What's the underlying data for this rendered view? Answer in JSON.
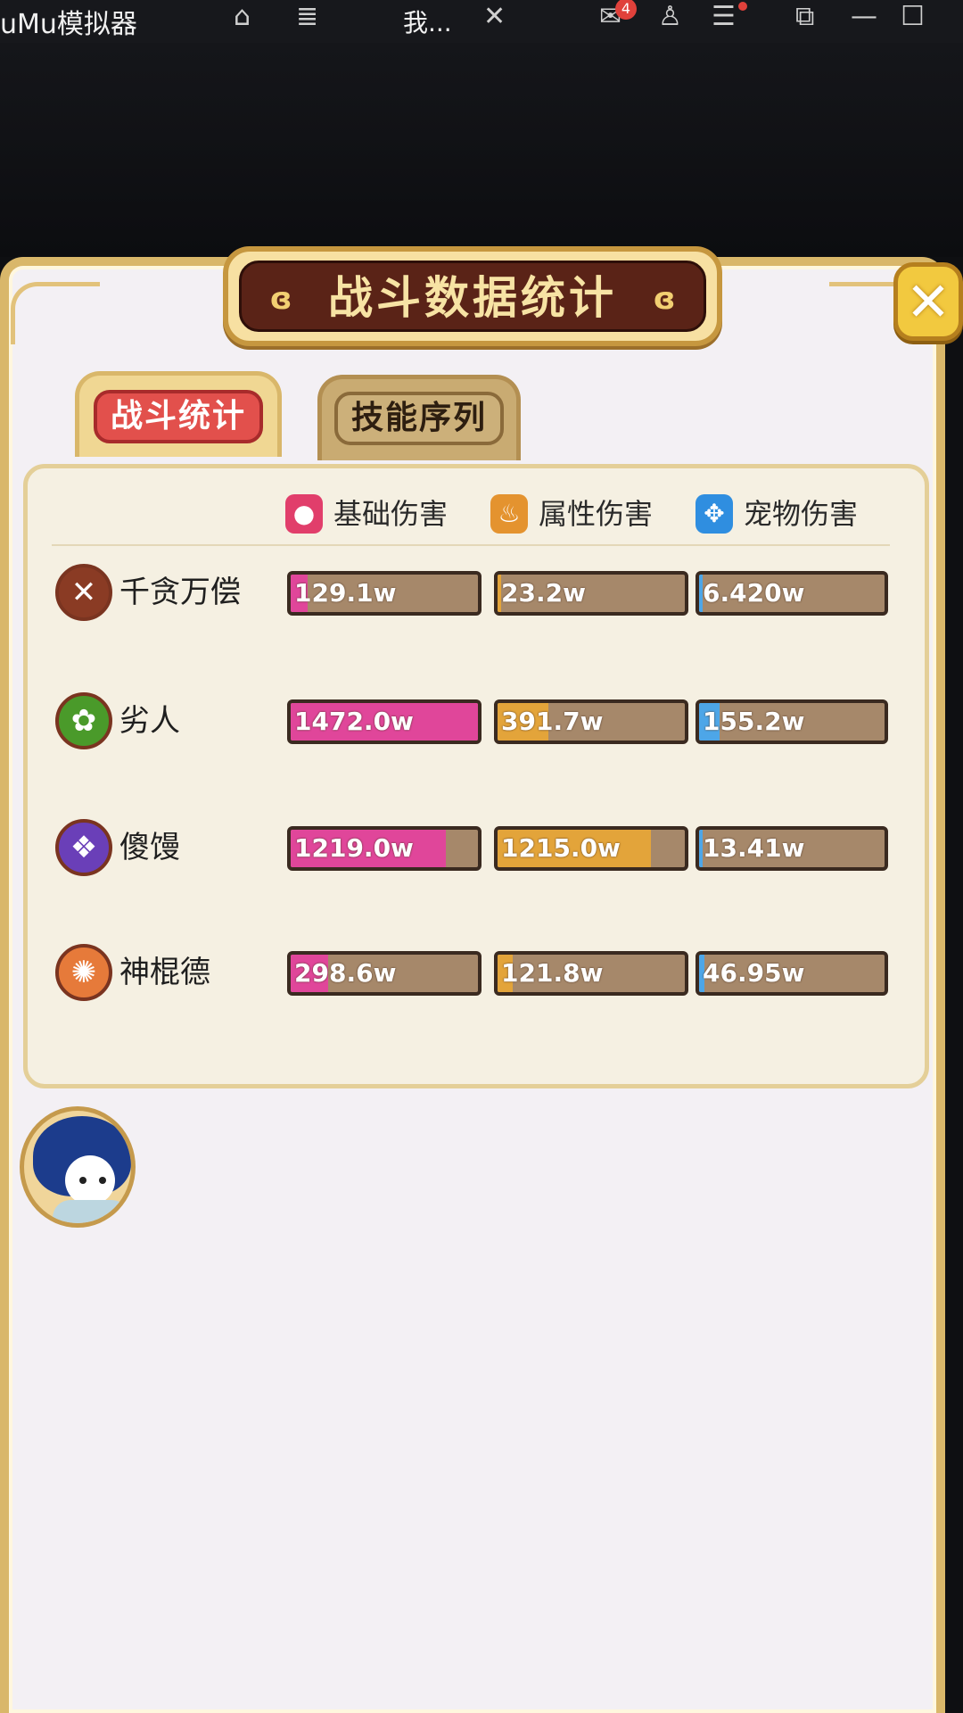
{
  "window": {
    "app_title": "uMu模拟器",
    "tab_label": "我...",
    "mail_badge": "4",
    "icons": [
      "home-icon",
      "list-icon",
      "close-icon",
      "mail-icon",
      "user-icon",
      "menu-icon",
      "resize-icon",
      "minimize-icon",
      "maximize-icon"
    ]
  },
  "panel": {
    "title": "战斗数据统计",
    "close_label": "✕",
    "tabs": [
      {
        "label": "战斗统计",
        "active": true
      },
      {
        "label": "技能序列",
        "active": false
      }
    ]
  },
  "columns": [
    {
      "label": "基础伤害",
      "icon": "person-icon",
      "color": "#e13e6b"
    },
    {
      "label": "属性伤害",
      "icon": "flame-icon",
      "color": "#e4932f"
    },
    {
      "label": "宠物伤害",
      "icon": "paw-icon",
      "color": "#2f8ee0"
    }
  ],
  "bar_colors": {
    "base": "#e0469a",
    "attribute": "#e3a43a",
    "pet": "#4da6e8"
  },
  "rows": [
    {
      "name": "千贪万偿",
      "avatar_color": "#8a3b24",
      "base": {
        "value": "129.1w",
        "fraction": 0.09
      },
      "attribute": {
        "value": "23.2w",
        "fraction": 0.02
      },
      "pet": {
        "value": "6.420w",
        "fraction": 0.02
      }
    },
    {
      "name": "劣人",
      "avatar_color": "#4a9a2a",
      "base": {
        "value": "1472.0w",
        "fraction": 1.0
      },
      "attribute": {
        "value": "391.7w",
        "fraction": 0.27
      },
      "pet": {
        "value": "155.2w",
        "fraction": 0.11
      }
    },
    {
      "name": "傻馒",
      "avatar_color": "#6a3fb8",
      "base": {
        "value": "1219.0w",
        "fraction": 0.83
      },
      "attribute": {
        "value": "1215.0w",
        "fraction": 0.82
      },
      "pet": {
        "value": "13.41w",
        "fraction": 0.02
      }
    },
    {
      "name": "神棍德",
      "avatar_color": "#e67a3a",
      "base": {
        "value": "298.6w",
        "fraction": 0.2
      },
      "attribute": {
        "value": "121.8w",
        "fraction": 0.08
      },
      "pet": {
        "value": "46.95w",
        "fraction": 0.03
      }
    }
  ]
}
